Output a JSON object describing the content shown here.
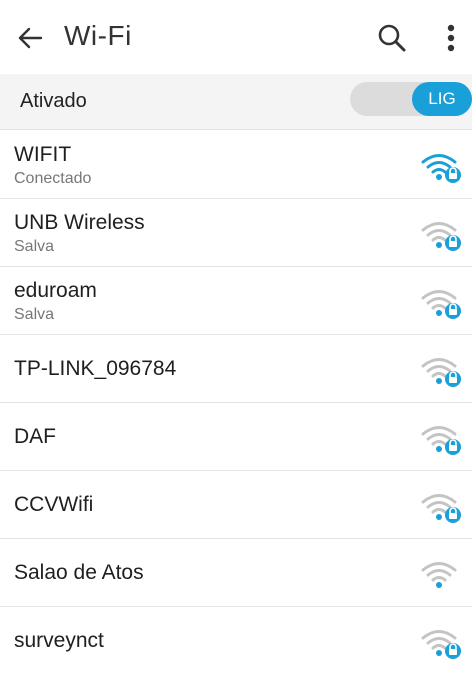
{
  "header": {
    "title": "Wi-Fi",
    "back_icon": "arrow-left-icon",
    "search_icon": "search-icon",
    "more_icon": "more-vert-icon"
  },
  "toggle": {
    "label": "Ativado",
    "state_label": "LIG",
    "on": true
  },
  "colors": {
    "accent": "#1aa0d8",
    "inactive_signal": "#c4c4c4"
  },
  "networks": [
    {
      "name": "WIFIT",
      "status": "Conectado",
      "secured": true,
      "connected": true
    },
    {
      "name": "UNB Wireless",
      "status": "Salva",
      "secured": true,
      "connected": false
    },
    {
      "name": "eduroam",
      "status": "Salva",
      "secured": true,
      "connected": false
    },
    {
      "name": "TP-LINK_096784",
      "status": "",
      "secured": true,
      "connected": false
    },
    {
      "name": "DAF",
      "status": "",
      "secured": true,
      "connected": false
    },
    {
      "name": "CCVWifi",
      "status": "",
      "secured": true,
      "connected": false
    },
    {
      "name": "Salao de Atos",
      "status": "",
      "secured": false,
      "connected": false
    },
    {
      "name": "surveynct",
      "status": "",
      "secured": true,
      "connected": false
    }
  ]
}
